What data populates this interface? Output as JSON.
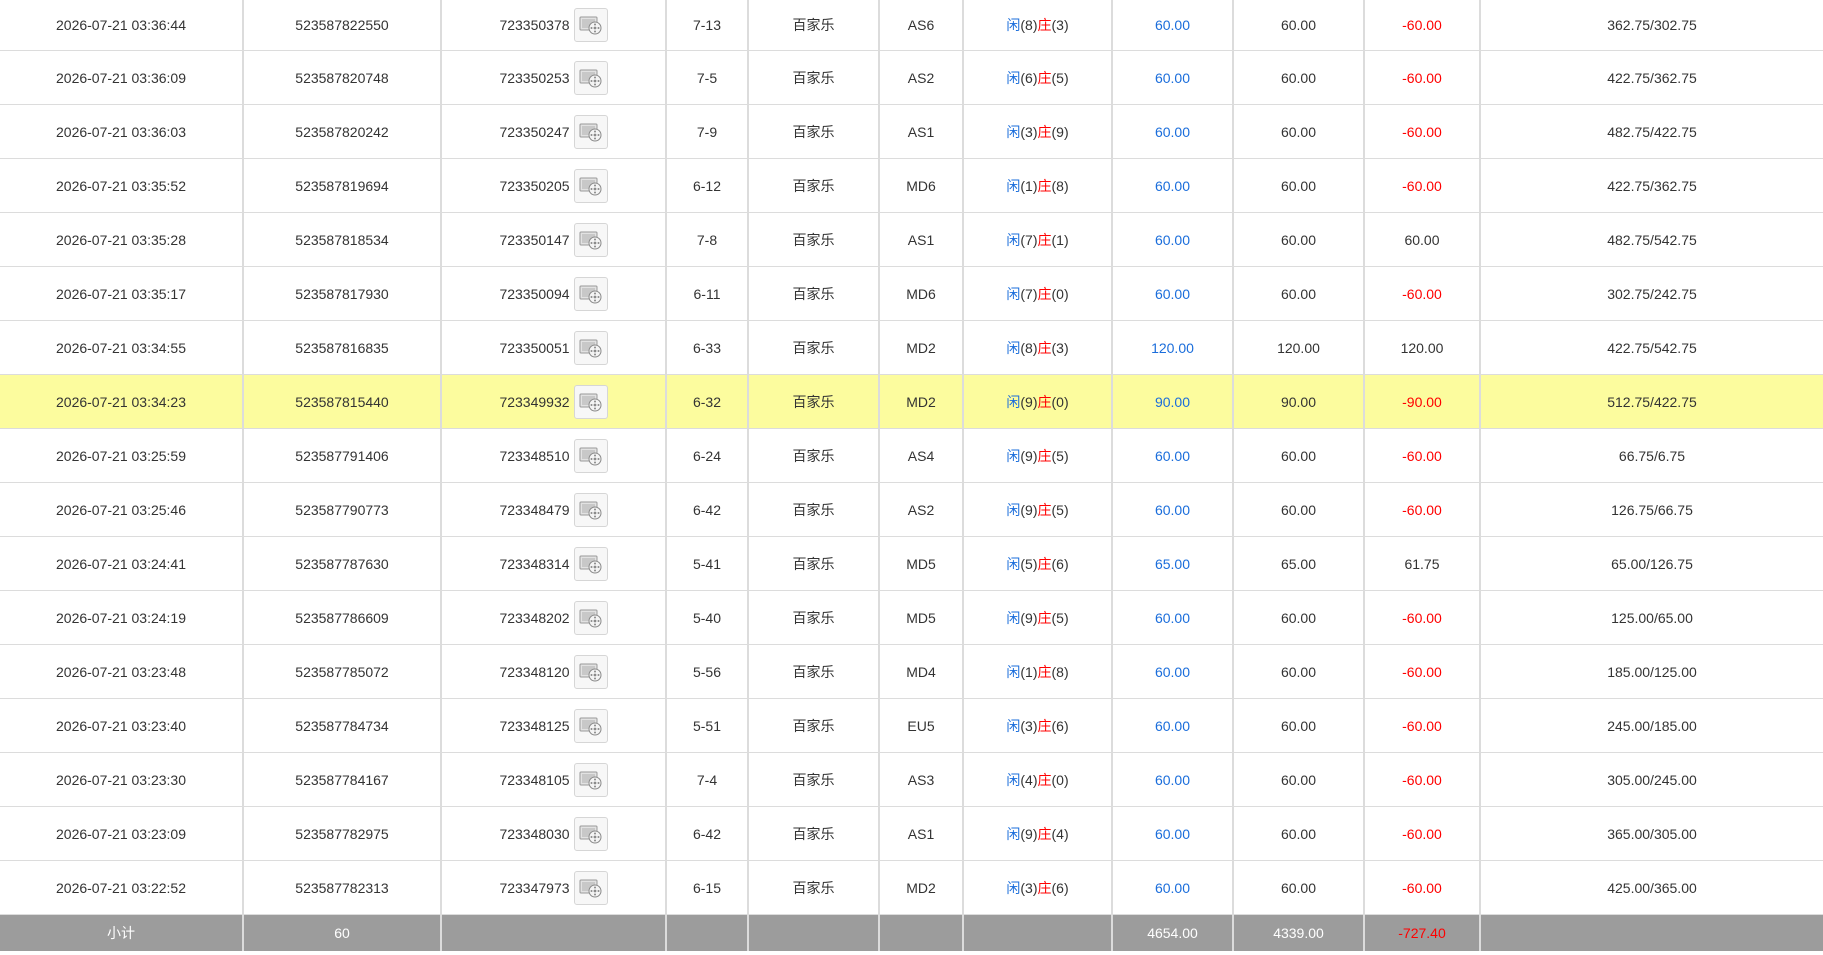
{
  "table": {
    "rows": [
      {
        "time": "2026-07-21 03:36:44",
        "bet_id": "523587822550",
        "game_id": "723350378",
        "shoe": "7-13",
        "game": "百家乐",
        "table": "AS6",
        "player": "8",
        "banker": "3",
        "bet": "60.00",
        "valid": "60.00",
        "winloss": "-60.00",
        "balance": "362.75/302.75"
      },
      {
        "time": "2026-07-21 03:36:09",
        "bet_id": "523587820748",
        "game_id": "723350253",
        "shoe": "7-5",
        "game": "百家乐",
        "table": "AS2",
        "player": "6",
        "banker": "5",
        "bet": "60.00",
        "valid": "60.00",
        "winloss": "-60.00",
        "balance": "422.75/362.75"
      },
      {
        "time": "2026-07-21 03:36:03",
        "bet_id": "523587820242",
        "game_id": "723350247",
        "shoe": "7-9",
        "game": "百家乐",
        "table": "AS1",
        "player": "3",
        "banker": "9",
        "bet": "60.00",
        "valid": "60.00",
        "winloss": "-60.00",
        "balance": "482.75/422.75"
      },
      {
        "time": "2026-07-21 03:35:52",
        "bet_id": "523587819694",
        "game_id": "723350205",
        "shoe": "6-12",
        "game": "百家乐",
        "table": "MD6",
        "player": "1",
        "banker": "8",
        "bet": "60.00",
        "valid": "60.00",
        "winloss": "-60.00",
        "balance": "422.75/362.75"
      },
      {
        "time": "2026-07-21 03:35:28",
        "bet_id": "523587818534",
        "game_id": "723350147",
        "shoe": "7-8",
        "game": "百家乐",
        "table": "AS1",
        "player": "7",
        "banker": "1",
        "bet": "60.00",
        "valid": "60.00",
        "winloss": "60.00",
        "balance": "482.75/542.75"
      },
      {
        "time": "2026-07-21 03:35:17",
        "bet_id": "523587817930",
        "game_id": "723350094",
        "shoe": "6-11",
        "game": "百家乐",
        "table": "MD6",
        "player": "7",
        "banker": "0",
        "bet": "60.00",
        "valid": "60.00",
        "winloss": "-60.00",
        "balance": "302.75/242.75"
      },
      {
        "time": "2026-07-21 03:34:55",
        "bet_id": "523587816835",
        "game_id": "723350051",
        "shoe": "6-33",
        "game": "百家乐",
        "table": "MD2",
        "player": "8",
        "banker": "3",
        "bet": "120.00",
        "valid": "120.00",
        "winloss": "120.00",
        "balance": "422.75/542.75"
      },
      {
        "time": "2026-07-21 03:34:23",
        "bet_id": "523587815440",
        "game_id": "723349932",
        "shoe": "6-32",
        "game": "百家乐",
        "table": "MD2",
        "player": "9",
        "banker": "0",
        "bet": "90.00",
        "valid": "90.00",
        "winloss": "-90.00",
        "balance": "512.75/422.75",
        "highlight": true
      },
      {
        "time": "2026-07-21 03:25:59",
        "bet_id": "523587791406",
        "game_id": "723348510",
        "shoe": "6-24",
        "game": "百家乐",
        "table": "AS4",
        "player": "9",
        "banker": "5",
        "bet": "60.00",
        "valid": "60.00",
        "winloss": "-60.00",
        "balance": "66.75/6.75"
      },
      {
        "time": "2026-07-21 03:25:46",
        "bet_id": "523587790773",
        "game_id": "723348479",
        "shoe": "6-42",
        "game": "百家乐",
        "table": "AS2",
        "player": "9",
        "banker": "5",
        "bet": "60.00",
        "valid": "60.00",
        "winloss": "-60.00",
        "balance": "126.75/66.75"
      },
      {
        "time": "2026-07-21 03:24:41",
        "bet_id": "523587787630",
        "game_id": "723348314",
        "shoe": "5-41",
        "game": "百家乐",
        "table": "MD5",
        "player": "5",
        "banker": "6",
        "bet": "65.00",
        "valid": "65.00",
        "winloss": "61.75",
        "balance": "65.00/126.75"
      },
      {
        "time": "2026-07-21 03:24:19",
        "bet_id": "523587786609",
        "game_id": "723348202",
        "shoe": "5-40",
        "game": "百家乐",
        "table": "MD5",
        "player": "9",
        "banker": "5",
        "bet": "60.00",
        "valid": "60.00",
        "winloss": "-60.00",
        "balance": "125.00/65.00"
      },
      {
        "time": "2026-07-21 03:23:48",
        "bet_id": "523587785072",
        "game_id": "723348120",
        "shoe": "5-56",
        "game": "百家乐",
        "table": "MD4",
        "player": "1",
        "banker": "8",
        "bet": "60.00",
        "valid": "60.00",
        "winloss": "-60.00",
        "balance": "185.00/125.00"
      },
      {
        "time": "2026-07-21 03:23:40",
        "bet_id": "523587784734",
        "game_id": "723348125",
        "shoe": "5-51",
        "game": "百家乐",
        "table": "EU5",
        "player": "3",
        "banker": "6",
        "bet": "60.00",
        "valid": "60.00",
        "winloss": "-60.00",
        "balance": "245.00/185.00"
      },
      {
        "time": "2026-07-21 03:23:30",
        "bet_id": "523587784167",
        "game_id": "723348105",
        "shoe": "7-4",
        "game": "百家乐",
        "table": "AS3",
        "player": "4",
        "banker": "0",
        "bet": "60.00",
        "valid": "60.00",
        "winloss": "-60.00",
        "balance": "305.00/245.00"
      },
      {
        "time": "2026-07-21 03:23:09",
        "bet_id": "523587782975",
        "game_id": "723348030",
        "shoe": "6-42",
        "game": "百家乐",
        "table": "AS1",
        "player": "9",
        "banker": "4",
        "bet": "60.00",
        "valid": "60.00",
        "winloss": "-60.00",
        "balance": "365.00/305.00"
      },
      {
        "time": "2026-07-21 03:22:52",
        "bet_id": "523587782313",
        "game_id": "723347973",
        "shoe": "6-15",
        "game": "百家乐",
        "table": "MD2",
        "player": "3",
        "banker": "6",
        "bet": "60.00",
        "valid": "60.00",
        "winloss": "-60.00",
        "balance": "425.00/365.00"
      }
    ],
    "labels": {
      "player": "闲",
      "banker": "庄"
    },
    "icons": {
      "video": "video-replay-icon"
    },
    "colors": {
      "positive_bet": "#1a6ddb",
      "negative": "#ff0000",
      "highlight": "#fcfc9e",
      "subtotal_bg": "#9c9c9c"
    }
  },
  "subtotal": {
    "label": "小计",
    "count": "60",
    "bet": "4654.00",
    "valid": "4339.00",
    "winloss": "-727.40"
  }
}
